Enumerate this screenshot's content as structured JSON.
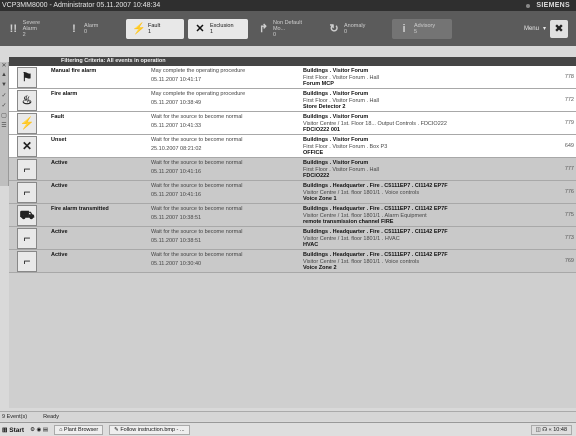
{
  "window": {
    "title": "VCP3MM8000 - Administrator   05.11.2007 10:48:34",
    "brand": "SIEMENS"
  },
  "alarm_bar": {
    "categories": [
      {
        "name": "Severe Alarm",
        "count": "2",
        "icon": "severe-alarm-icon",
        "glyph": "!!"
      },
      {
        "name": "Alarm",
        "count": "0",
        "icon": "alarm-icon",
        "glyph": "!"
      },
      {
        "name": "Fault",
        "count": "1",
        "icon": "fault-icon",
        "glyph": "⚡"
      },
      {
        "name": "Exclusion",
        "count": "1",
        "icon": "exclusion-icon",
        "glyph": "✕"
      },
      {
        "name": "Non Default Mo...",
        "count": "0",
        "icon": "non-default-icon",
        "glyph": "↱"
      },
      {
        "name": "Anomaly",
        "count": "0",
        "icon": "anomaly-icon",
        "glyph": "↻"
      },
      {
        "name": "Advisory",
        "count": "5",
        "icon": "advisory-icon",
        "glyph": "i"
      }
    ],
    "menu_label": "Menu"
  },
  "filter_text": "Filtering Criteria: All events in operation",
  "events": [
    {
      "icon": "manual-fire-alarm-icon",
      "glyph": "⚑",
      "condition": "Manual fire alarm",
      "info": "May complete the operating procedure",
      "datetime": "05.11.2007  10:41:17",
      "loc1": "Buildings . Visitor Forum",
      "loc2": "First Floor . Visitor Forum . Hall",
      "loc3": "Forum MCP",
      "id": "778"
    },
    {
      "icon": "fire-alarm-icon",
      "glyph": "♨",
      "condition": "Fire alarm",
      "info": "May complete the operating procedure",
      "datetime": "05.11.2007  10:38:49",
      "loc1": "Buildings . Visitor Forum",
      "loc2": "First Floor . Visitor Forum . Hall",
      "loc3": "Store Detector 2",
      "id": "772"
    },
    {
      "icon": "fault-icon",
      "glyph": "⚡",
      "condition": "Fault",
      "info": "Wait for the source to become normal",
      "datetime": "05.11.2007  10:41:33",
      "loc1": "Buildings . Visitor Forum",
      "loc2": "Visitor Centre / 1st. Floor 18... Output Controls . FDCIO222",
      "loc3": "FDCIO222 001",
      "id": "779"
    },
    {
      "icon": "unset-icon",
      "glyph": "✕",
      "condition": "Unset",
      "info": "Wait for the source to become normal",
      "datetime": "25.10.2007  08:21:02",
      "loc1": "Buildings . Visitor Forum",
      "loc2": "First Floor . Visitor Forum . Box P3",
      "loc3": "OFFICE",
      "id": "649"
    },
    {
      "icon": "active-icon",
      "glyph": "⌐",
      "condition": "Active",
      "info": "Wait for the source to become normal",
      "datetime": "05.11.2007  10:41:16",
      "loc1": "Buildings . Visitor Forum",
      "loc2": "First Floor . Visitor Forum . Hall",
      "loc3": "FDCIO222",
      "id": "777"
    },
    {
      "icon": "active-icon",
      "glyph": "⌐",
      "condition": "Active",
      "info": "Wait for the source to become normal",
      "datetime": "05.11.2007  10:41:16",
      "loc1": "Buildings . Headquarter . Fire . C5111EP7 . CI1142 EP7F",
      "loc2": "Visitor Centre / 1st. floor 1801/1 . Voice controls",
      "loc3": "Voice Zone 1",
      "id": "776"
    },
    {
      "icon": "fire-alarm-transmitted-icon",
      "glyph": "⛟",
      "condition": "Fire alarm transmitted",
      "info": "Wait for the source to become normal",
      "datetime": "05.11.2007  10:38:51",
      "loc1": "Buildings . Headquarter . Fire . C5111EP7 . CI1142 EP7F",
      "loc2": "Visitor Centre / 1st. floor 1801/1 . Alarm Equipment",
      "loc3": "remote transmission channel FIRE",
      "id": "775"
    },
    {
      "icon": "active-icon",
      "glyph": "⌐",
      "condition": "Active",
      "info": "Wait for the source to become normal",
      "datetime": "05.11.2007  10:38:51",
      "loc1": "Buildings . Headquarter . Fire . C5111EP7 . CI1142 EP7F",
      "loc2": "Visitor Centre / 1st. floor 1801/1 . HVAC",
      "loc3": "HVAC",
      "id": "773"
    },
    {
      "icon": "active-icon",
      "glyph": "⌐",
      "condition": "Active",
      "info": "Wait for the source to become normal",
      "datetime": "05.11.2007  10:30:40",
      "loc1": "Buildings . Headquarter . Fire . C5111EP7 . CI1142 EP7F",
      "loc2": "Visitor Centre / 1st. floor 1801/1 . Voice controls",
      "loc3": "Voice Zone 2",
      "id": "769"
    }
  ],
  "status": {
    "event_count": "9 Event(s)",
    "state": "Ready"
  },
  "taskbar": {
    "start": "Start",
    "task1": "Plant Browser",
    "task2": "Follow instruction.bmp - ...",
    "clock": "10:48"
  }
}
